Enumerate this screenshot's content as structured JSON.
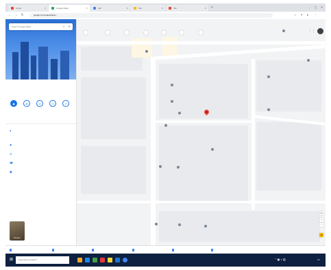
{
  "browser": {
    "tabs": [
      {
        "title": "Gmail",
        "favicon_color": "#ea4335"
      },
      {
        "title": "Google Maps",
        "favicon_color": "#34a853",
        "active": true
      },
      {
        "title": "Tab",
        "favicon_color": "#4285f4"
      },
      {
        "title": "Tab",
        "favicon_color": "#fbbc05"
      },
      {
        "title": "Tab",
        "favicon_color": "#ea4335"
      }
    ],
    "new_tab_label": "+",
    "address": "google.com/maps/place/...",
    "nav": {
      "back": "←",
      "forward": "→",
      "reload": "↻"
    }
  },
  "panel": {
    "search_value": "",
    "search_placeholder": "Search Google Maps",
    "place_name": "",
    "place_subtitle": "",
    "actions": [
      {
        "label": "",
        "icon": "◆"
      },
      {
        "label": "",
        "icon": "★"
      },
      {
        "label": "",
        "icon": "⊙"
      },
      {
        "label": "",
        "icon": "▢"
      },
      {
        "label": "",
        "icon": "↗"
      }
    ],
    "rows": [
      {
        "icon": "●",
        "text": ""
      },
      {
        "icon": "✚",
        "text": ""
      },
      {
        "icon": "◎",
        "text": ""
      },
      {
        "icon": "☎",
        "text": ""
      },
      {
        "icon": "▣",
        "text": ""
      }
    ],
    "photo_label": "Photos"
  },
  "map": {
    "category_pills": [
      "",
      "",
      "",
      "",
      "",
      "",
      ""
    ],
    "pois": [
      "",
      "",
      "",
      "",
      "",
      "",
      "",
      "",
      "",
      "",
      "",
      "",
      "",
      "",
      ""
    ],
    "scale_label": ""
  },
  "downloads": {
    "items": [
      "",
      "",
      "",
      "",
      "",
      ""
    ],
    "show_all": ""
  },
  "taskbar": {
    "search_placeholder": "Type here to search",
    "app_colors": [
      "#f9a825",
      "#1e88e5",
      "#43a047",
      "#e53935",
      "#fdd835",
      "#1976d2",
      "#4285f4"
    ],
    "clock": ""
  },
  "colors": {
    "accent": "#1a73e8",
    "pin": "#ea4335",
    "taskbar": "#0f2140"
  }
}
